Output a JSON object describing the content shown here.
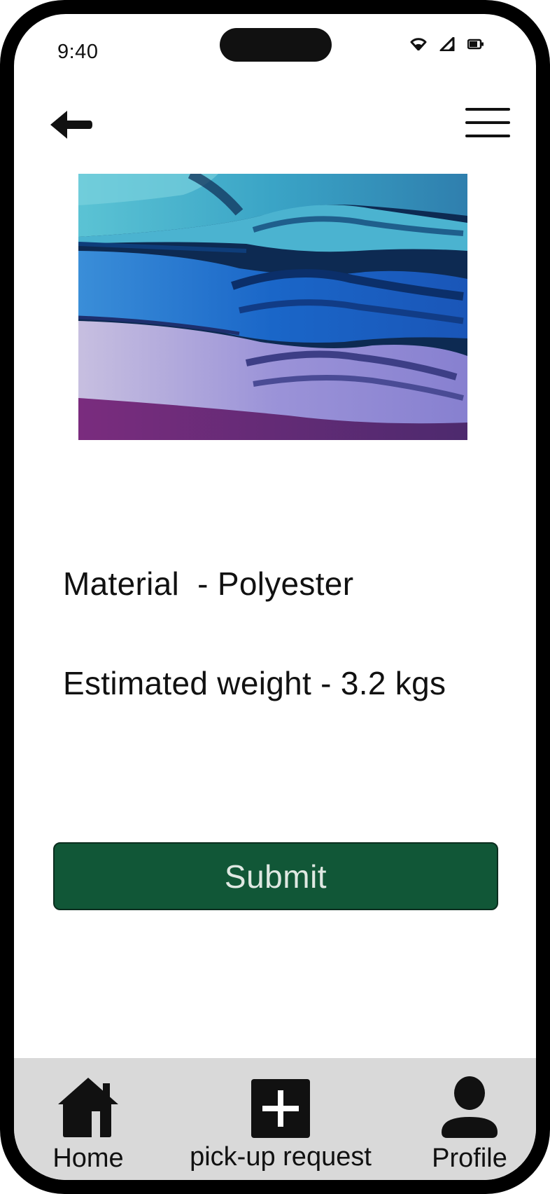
{
  "status_bar": {
    "time": "9:40",
    "icons": [
      "wifi-icon",
      "signal-icon",
      "battery-icon"
    ]
  },
  "top_nav": {
    "back_icon": "arrow-left-icon",
    "menu_icon": "hamburger-menu-icon"
  },
  "item": {
    "image_subject": "fabric-stack-image",
    "material_line": "Material  - Polyester",
    "weight_line": "Estimated weight - 3.2 kgs"
  },
  "actions": {
    "submit_label": "Submit"
  },
  "bottom_nav": {
    "items": [
      {
        "label": "Home",
        "icon": "home-icon"
      },
      {
        "label": "pick-up request",
        "icon": "plus-square-icon"
      },
      {
        "label": "Profile",
        "icon": "user-icon"
      }
    ]
  },
  "colors": {
    "primary_button": "#115737",
    "button_text": "#dfe8e2",
    "nav_background": "#d9d9d9",
    "frame": "#000000"
  }
}
